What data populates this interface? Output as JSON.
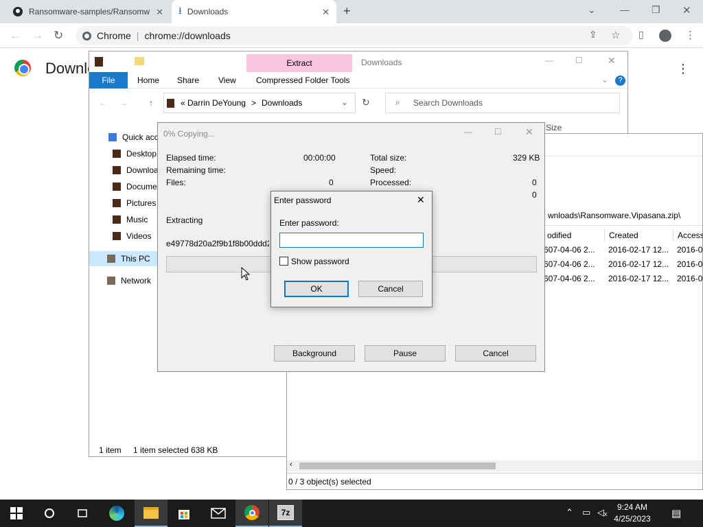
{
  "chrome": {
    "tabs": [
      {
        "title": "Ransomware-samples/Ransomw"
      },
      {
        "title": "Downloads"
      }
    ],
    "new_tab": "+",
    "omnibox_scheme": "Chrome",
    "omnibox_url": "chrome://downloads",
    "page_heading": "Downloads"
  },
  "explorer": {
    "context_tab": "Extract",
    "title": "Downloads",
    "ribbon_tabs": [
      "File",
      "Home",
      "Share",
      "View",
      "Compressed Folder Tools"
    ],
    "address": {
      "part1": "Darrin DeYoung",
      "sep": ">",
      "part2": "Downloads",
      "prefix": "<<"
    },
    "search_placeholder": "Search Downloads",
    "nav": [
      "Quick acc",
      "Desktop",
      "Download",
      "Documen",
      "Pictures",
      "Music",
      "Videos",
      "This PC",
      "Network"
    ],
    "column_size": "Size",
    "status_count": "1 item",
    "status_selected": "1 item selected  638 KB"
  },
  "sevenzip": {
    "path": "wnloads\\Ransomware.Vipasana.zip\\",
    "columns": [
      "odified",
      "Created",
      "Access"
    ],
    "rows": [
      {
        "modified": "607-04-06 2...",
        "created": "2016-02-17 12...",
        "access": "2016-0"
      },
      {
        "modified": "607-04-06 2...",
        "created": "2016-02-17 12...",
        "access": "2016-0"
      },
      {
        "modified": "607-04-06 2...",
        "created": "2016-02-17 12...",
        "access": "2016-0"
      }
    ],
    "status": "0 / 3 object(s) selected"
  },
  "copy": {
    "title": "0% Copying...",
    "elapsed_label": "Elapsed time:",
    "elapsed_value": "00:00:00",
    "remaining_label": "Remaining time:",
    "files_label": "Files:",
    "files_value": "0",
    "total_size_label": "Total size:",
    "total_size_value": "329 KB",
    "speed_label": "Speed:",
    "processed_label": "Processed:",
    "processed_value": "0",
    "processed_value2": "0",
    "extracting_label": "Extracting",
    "extracting_file": "e49778d20a2f9b1f8b00ddd24b6",
    "buttons": {
      "background": "Background",
      "pause": "Pause",
      "cancel": "Cancel"
    }
  },
  "password_dialog": {
    "title": "Enter password",
    "close": "✕",
    "label": "Enter password:",
    "input_value": "",
    "show_password": "Show password",
    "ok": "OK",
    "cancel": "Cancel"
  },
  "taskbar": {
    "time": "9:24 AM",
    "date": "4/25/2023",
    "sevenzip_label": "7z"
  }
}
